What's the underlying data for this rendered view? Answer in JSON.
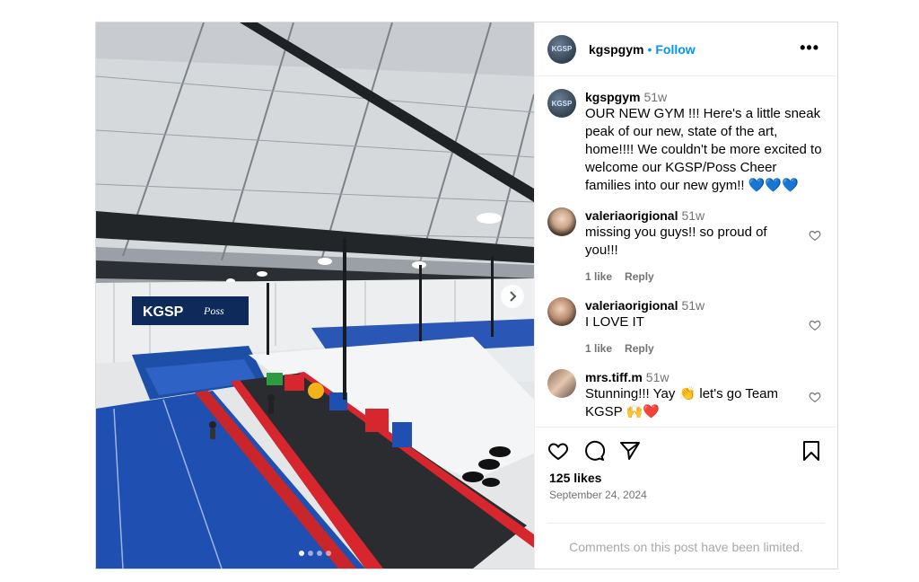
{
  "post": {
    "username": "kgspgym",
    "separator": "•",
    "follow_label": "Follow",
    "more_label": "•••",
    "avatar_text": "KGSP",
    "image_dots": 4,
    "active_dot": 0
  },
  "caption": {
    "username": "kgspgym",
    "time": "51w",
    "text": "OUR NEW GYM !!! Here's a little sneak peak of our new, state of the art, home!!!! We couldn't be more excited to welcome our KGSP/Poss Cheer families into our new gym!! 💙💙💙"
  },
  "comments": [
    {
      "username": "valeriaorigional",
      "time": "51w",
      "text": "missing you guys!! so proud of you!!!",
      "likes": "1 like",
      "reply": "Reply"
    },
    {
      "username": "valeriaorigional",
      "time": "51w",
      "text": "I LOVE IT",
      "likes": "1 like",
      "reply": "Reply"
    },
    {
      "username": "mrs.tiff.m",
      "time": "51w",
      "text": "Stunning!!! Yay 👏 let's go Team KGSP 🙌❤️",
      "likes": "",
      "reply": ""
    }
  ],
  "footer": {
    "likes": "125 likes",
    "date": "September 24, 2024",
    "limited": "Comments on this post have been limited."
  },
  "banner": {
    "left": "KGSP",
    "right": "Poss"
  },
  "icons": [
    "heart-icon",
    "comment-icon",
    "share-icon",
    "bookmark-icon",
    "chevron-right-icon",
    "more-icon"
  ]
}
